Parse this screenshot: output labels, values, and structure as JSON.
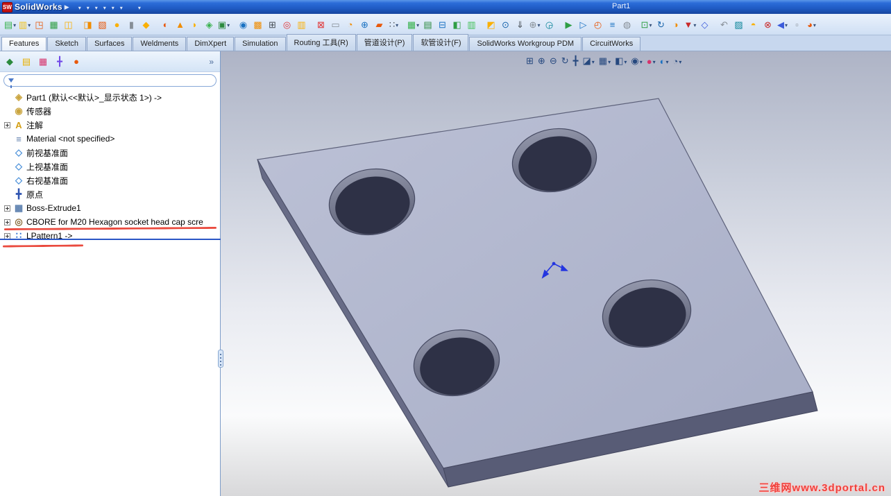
{
  "titlebar": {
    "app_name": "SolidWorks",
    "logo_text": "SW",
    "menu_arrow": "▶",
    "document_title": "Part1",
    "icons": [
      {
        "name": "new-document-icon",
        "kind": "doc",
        "dropdown": true
      },
      {
        "name": "open-folder-icon",
        "kind": "folder",
        "dropdown": true
      },
      {
        "name": "save-icon",
        "kind": "save",
        "dropdown": true
      },
      {
        "name": "print-icon",
        "kind": "print",
        "dropdown": true
      },
      {
        "name": "undo-icon",
        "kind": "undo",
        "dropdown": true
      },
      {
        "name": "select-cursor-icon",
        "kind": "cursor",
        "dropdown": true
      },
      {
        "name": "rebuild-icon",
        "kind": "rebuild"
      },
      {
        "name": "file-properties-icon",
        "kind": "box"
      },
      {
        "name": "options-icon",
        "kind": "list",
        "dropdown": true
      }
    ]
  },
  "toolbar2": {
    "icons": [
      {
        "name": "toolbar2-icon",
        "glyph": "▤",
        "color": "#37b24d",
        "dropdown": true
      },
      {
        "name": "toolbar2-icon",
        "glyph": "▥",
        "color": "#f1c21b",
        "dropdown": true
      },
      {
        "name": "toolbar2-icon",
        "glyph": "◳",
        "color": "#e8590c"
      },
      {
        "name": "toolbar2-icon",
        "glyph": "▦",
        "color": "#2f9e44"
      },
      {
        "name": "toolbar2-icon",
        "glyph": "◫",
        "color": "#fab005"
      },
      {
        "name": "toolbar2-icon",
        "glyph": "◨",
        "color": "#f08c00",
        "gap": true
      },
      {
        "name": "toolbar2-icon",
        "glyph": "▧",
        "color": "#e8590c"
      },
      {
        "name": "toolbar2-icon",
        "glyph": "●",
        "color": "#fab005"
      },
      {
        "name": "toolbar2-icon",
        "glyph": "▮",
        "color": "#868e96"
      },
      {
        "name": "toolbar2-icon",
        "glyph": "◆",
        "color": "#fab005"
      },
      {
        "name": "toolbar2-icon",
        "glyph": "◐",
        "color": "#e8590c",
        "gap": true
      },
      {
        "name": "toolbar2-icon",
        "glyph": "▲",
        "color": "#f08c00"
      },
      {
        "name": "toolbar2-icon",
        "glyph": "◗",
        "color": "#fab005"
      },
      {
        "name": "toolbar2-icon",
        "glyph": "◈",
        "color": "#37b24d"
      },
      {
        "name": "toolbar2-icon",
        "glyph": "▣",
        "color": "#2b8a3e",
        "dropdown": true
      },
      {
        "name": "toolbar2-icon",
        "glyph": "◉",
        "color": "#1971c2",
        "gap": true
      },
      {
        "name": "toolbar2-icon",
        "glyph": "▩",
        "color": "#f08c00"
      },
      {
        "name": "toolbar2-icon",
        "glyph": "⊞",
        "color": "#495057"
      },
      {
        "name": "toolbar2-icon",
        "glyph": "◎",
        "color": "#e03131"
      },
      {
        "name": "toolbar2-icon",
        "glyph": "▥",
        "color": "#fab005"
      },
      {
        "name": "toolbar2-icon",
        "glyph": "⊠",
        "color": "#e03131",
        "gap": true
      },
      {
        "name": "toolbar2-icon",
        "glyph": "▭",
        "color": "#868e96"
      },
      {
        "name": "toolbar2-icon",
        "glyph": "◔",
        "color": "#f08c00"
      },
      {
        "name": "toolbar2-icon",
        "glyph": "⊕",
        "color": "#1971c2"
      },
      {
        "name": "toolbar2-icon",
        "glyph": "▰",
        "color": "#e8590c"
      },
      {
        "name": "toolbar2-icon",
        "glyph": "∷",
        "color": "#495057",
        "dropdown": true
      },
      {
        "name": "toolbar2-icon",
        "glyph": "▦",
        "color": "#37b24d",
        "dropdown": true,
        "gap": true
      },
      {
        "name": "toolbar2-icon",
        "glyph": "▤",
        "color": "#2b8a3e"
      },
      {
        "name": "toolbar2-icon",
        "glyph": "⊟",
        "color": "#1971c2"
      },
      {
        "name": "toolbar2-icon",
        "glyph": "◧",
        "color": "#2f9e44"
      },
      {
        "name": "toolbar2-icon",
        "glyph": "▥",
        "color": "#40c057"
      },
      {
        "name": "toolbar2-icon",
        "glyph": "◩",
        "color": "#fab005",
        "gap": true
      },
      {
        "name": "toolbar2-icon",
        "glyph": "⊙",
        "color": "#1864ab"
      },
      {
        "name": "toolbar2-icon",
        "glyph": "⇓",
        "color": "#495057"
      },
      {
        "name": "toolbar2-icon",
        "glyph": "⊕",
        "color": "#868e96",
        "dropdown": true
      },
      {
        "name": "toolbar2-icon",
        "glyph": "◶",
        "color": "#0c8599"
      },
      {
        "name": "toolbar2-icon",
        "glyph": "▶",
        "color": "#2f9e44",
        "gap": true
      },
      {
        "name": "toolbar2-icon",
        "glyph": "▷",
        "color": "#1971c2"
      },
      {
        "name": "toolbar2-icon",
        "glyph": "◴",
        "color": "#e8590c"
      },
      {
        "name": "toolbar2-icon",
        "glyph": "≡",
        "color": "#1971c2"
      },
      {
        "name": "toolbar2-icon",
        "glyph": "◍",
        "color": "#868e96"
      },
      {
        "name": "toolbar2-icon",
        "glyph": "⊡",
        "color": "#2f9e44",
        "dropdown": true,
        "gap": true
      },
      {
        "name": "toolbar2-icon",
        "glyph": "↻",
        "color": "#1864ab"
      },
      {
        "name": "toolbar2-icon",
        "glyph": "◑",
        "color": "#f08c00"
      },
      {
        "name": "toolbar2-icon",
        "glyph": "▼",
        "color": "#c92a2a",
        "dropdown": true
      },
      {
        "name": "toolbar2-icon",
        "glyph": "◇",
        "color": "#3b5bdb"
      },
      {
        "name": "toolbar2-icon",
        "glyph": "↶",
        "color": "#868e96",
        "gap": true
      },
      {
        "name": "toolbar2-icon",
        "glyph": "▨",
        "color": "#0c8599"
      },
      {
        "name": "toolbar2-icon",
        "glyph": "◓",
        "color": "#fab005"
      },
      {
        "name": "toolbar2-icon",
        "glyph": "⊗",
        "color": "#c92a2a"
      },
      {
        "name": "toolbar2-icon",
        "glyph": "◀",
        "color": "#3b5bdb",
        "dropdown": true
      },
      {
        "name": "toolbar2-icon",
        "glyph": "▫",
        "color": "#868e96"
      },
      {
        "name": "toolbar2-icon",
        "glyph": "◕",
        "color": "#e8590c",
        "dropdown": true
      }
    ]
  },
  "ribbon": {
    "tabs": [
      {
        "label": "Features",
        "active": true
      },
      {
        "label": "Sketch"
      },
      {
        "label": "Surfaces"
      },
      {
        "label": "Weldments"
      },
      {
        "label": "DimXpert"
      },
      {
        "label": "Simulation"
      },
      {
        "label": "Routing 工具(R)"
      },
      {
        "label": "管道设计(P)"
      },
      {
        "label": "软管设计(F)"
      },
      {
        "label": "SolidWorks Workgroup PDM"
      },
      {
        "label": "CircuitWorks"
      }
    ]
  },
  "panel": {
    "overflow_label": "»",
    "filter_placeholder": "",
    "tabs": [
      {
        "name": "featuremanager-tab-icon",
        "glyph": "◆",
        "color": "#2b8a3e"
      },
      {
        "name": "propertymanager-tab-icon",
        "glyph": "▤",
        "color": "#e8b000"
      },
      {
        "name": "configurationmanager-tab-icon",
        "glyph": "▦",
        "color": "#d6336c"
      },
      {
        "name": "dimxpertmanager-tab-icon",
        "glyph": "╋",
        "color": "#7048e8"
      },
      {
        "name": "displaymanager-tab-icon",
        "glyph": "●",
        "color": "#e8590c"
      }
    ],
    "tree": {
      "root": {
        "label": "Part1 (默认<<默认>_显示状态 1>) ->",
        "icon": "part-icon",
        "glyph": "◈"
      },
      "items": [
        {
          "label": "传感器",
          "icon": "sensors-icon",
          "glyph": "◉",
          "color": "#caa53f"
        },
        {
          "label": "注解",
          "icon": "annotations-folder-icon",
          "glyph": "A",
          "color": "#d4a017",
          "expand": true
        },
        {
          "label": "Material <not specified>",
          "icon": "material-icon",
          "glyph": "≡",
          "color": "#5f7fae"
        },
        {
          "label": "前视基准面",
          "icon": "front-plane-icon",
          "glyph": "◇",
          "color": "#4a90d9"
        },
        {
          "label": "上视基准面",
          "icon": "top-plane-icon",
          "glyph": "◇",
          "color": "#4a90d9"
        },
        {
          "label": "右视基准面",
          "icon": "right-plane-icon",
          "glyph": "◇",
          "color": "#4a90d9"
        },
        {
          "label": "原点",
          "icon": "origin-icon",
          "glyph": "╋",
          "color": "#2f54b0"
        },
        {
          "label": "Boss-Extrude1",
          "icon": "boss-extrude-icon",
          "glyph": "▦",
          "color": "#5b7fae",
          "expand": true
        },
        {
          "label": "CBORE for M20 Hexagon socket head cap scre",
          "icon": "hole-wizard-icon",
          "glyph": "◎",
          "color": "#8a6d3b",
          "expand": true
        },
        {
          "label": "LPattern1 ->",
          "icon": "linear-pattern-icon",
          "glyph": "∷",
          "color": "#2e6fd0",
          "expand": true
        }
      ]
    }
  },
  "viewport": {
    "watermark": "三维网www.3dportal.cn",
    "hud_icons": [
      {
        "name": "zoom-to-fit-icon",
        "glyph": "⊞"
      },
      {
        "name": "zoom-to-area-icon",
        "glyph": "⊕"
      },
      {
        "name": "zoom-in-out-icon",
        "glyph": "⊖"
      },
      {
        "name": "rotate-view-icon",
        "glyph": "↻"
      },
      {
        "name": "pan-icon",
        "glyph": "╋"
      },
      {
        "name": "section-view-icon",
        "glyph": "◪",
        "dropdown": true
      },
      {
        "name": "view-orientation-icon",
        "glyph": "▦",
        "dropdown": true
      },
      {
        "name": "display-style-icon",
        "glyph": "◧",
        "dropdown": true
      },
      {
        "name": "hide-show-items-icon",
        "glyph": "◉",
        "dropdown": true
      },
      {
        "name": "edit-appearance-icon",
        "glyph": "●",
        "color": "#d6336c",
        "dropdown": true
      },
      {
        "name": "apply-scene-icon",
        "glyph": "◐",
        "color": "#1971c2",
        "dropdown": true
      },
      {
        "name": "view-settings-icon",
        "glyph": "◔",
        "dropdown": true
      }
    ]
  }
}
